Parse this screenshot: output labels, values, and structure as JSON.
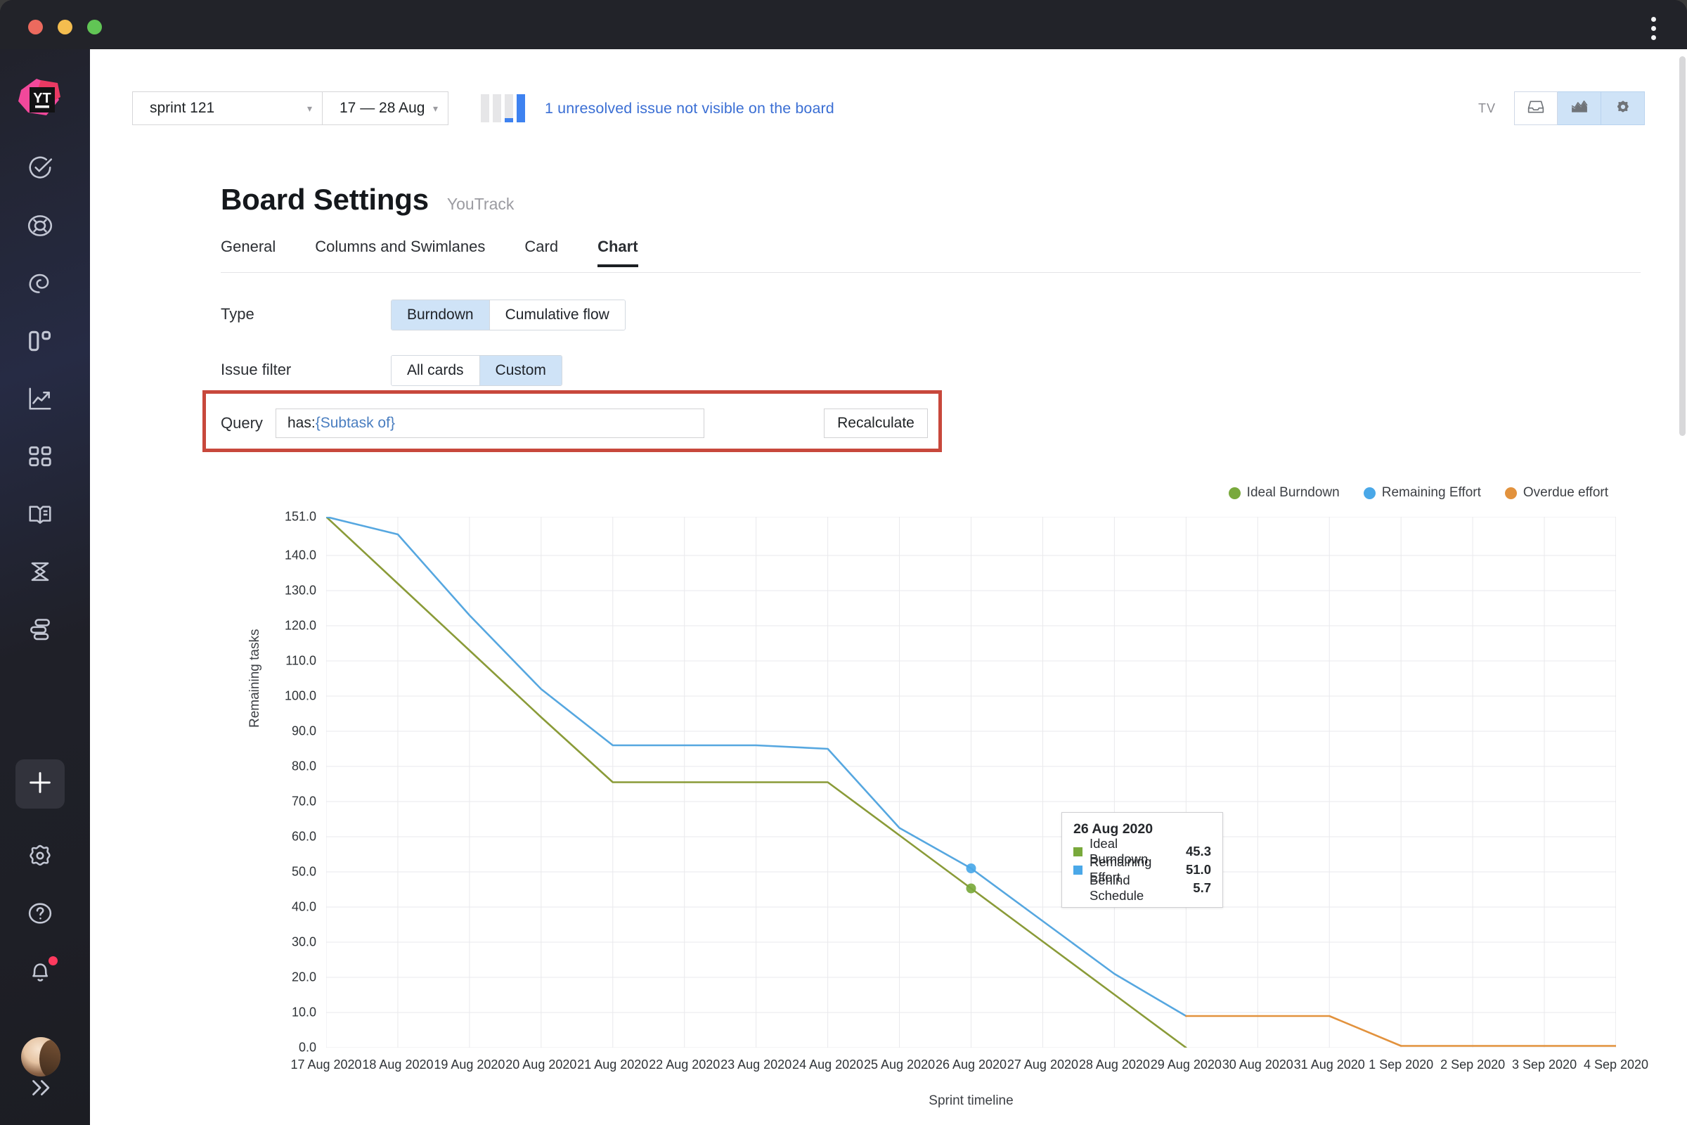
{
  "window": {
    "traffic_lights": [
      "close",
      "minimize",
      "zoom"
    ],
    "menu_icon": "kebab-menu-icon"
  },
  "sidebar": {
    "logo_label": "YT",
    "items": [
      {
        "name": "sidebar-item-issues",
        "icon": "check-circle-icon"
      },
      {
        "name": "sidebar-item-agile",
        "icon": "target-icon"
      },
      {
        "name": "sidebar-item-reports",
        "icon": "spiral-icon"
      },
      {
        "name": "sidebar-item-boards",
        "icon": "board-columns-icon"
      },
      {
        "name": "sidebar-item-analytics",
        "icon": "trend-up-icon"
      },
      {
        "name": "sidebar-item-dashboard",
        "icon": "grid-squares-icon"
      },
      {
        "name": "sidebar-item-knowledge",
        "icon": "book-open-icon"
      },
      {
        "name": "sidebar-item-timesheet",
        "icon": "hourglass-icon"
      },
      {
        "name": "sidebar-item-workflows",
        "icon": "layers-icon"
      }
    ],
    "add_button": {
      "name": "create-button",
      "icon": "plus-icon"
    },
    "bottom_items": [
      {
        "name": "sidebar-item-settings",
        "icon": "gear-icon"
      },
      {
        "name": "sidebar-item-help",
        "icon": "question-circle-icon"
      },
      {
        "name": "sidebar-item-notifications",
        "icon": "bell-icon",
        "badge": true
      }
    ],
    "avatar": {
      "name": "avatar",
      "icon": "user-avatar"
    },
    "expand": {
      "name": "expand-sidebar-button",
      "icon": "chevron-double-right-icon"
    }
  },
  "topbar": {
    "sprint_select": {
      "value": "sprint 121",
      "caret": "chevron-down-icon"
    },
    "date_select": {
      "value": "17 — 28 Aug",
      "caret": "chevron-down-icon"
    },
    "banner_text": "1 unresolved issue not visible on the board",
    "tv_label": "TV",
    "buttons": [
      {
        "name": "archive-button",
        "icon": "inbox-icon",
        "active": false
      },
      {
        "name": "chart-button",
        "icon": "chart-icon",
        "active": true
      },
      {
        "name": "settings-button",
        "icon": "gear-icon",
        "active": true
      }
    ]
  },
  "header": {
    "title": "Board Settings",
    "subtitle": "YouTrack"
  },
  "tabs": [
    {
      "label": "General",
      "active": false
    },
    {
      "label": "Columns and Swimlanes",
      "active": false
    },
    {
      "label": "Card",
      "active": false
    },
    {
      "label": "Chart",
      "active": true
    }
  ],
  "settings": {
    "type": {
      "label": "Type",
      "options": [
        {
          "label": "Burndown",
          "selected": true
        },
        {
          "label": "Cumulative flow",
          "selected": false
        }
      ]
    },
    "issue_filter": {
      "label": "Issue filter",
      "options": [
        {
          "label": "All cards",
          "selected": false
        },
        {
          "label": "Custom",
          "selected": true
        }
      ]
    },
    "query": {
      "label": "Query",
      "prefix": "has: ",
      "token": "{Subtask of}",
      "value": "has: {Subtask of}",
      "placeholder": "",
      "button_label": "Recalculate",
      "highlight_color": "#c8483c"
    }
  },
  "chart_data": {
    "type": "line",
    "title": "",
    "xlabel": "Sprint timeline",
    "ylabel": "Remaining tasks",
    "grid": true,
    "legend_position": "top-right",
    "ylim": [
      0,
      151
    ],
    "yticks": [
      0.0,
      10.0,
      20.0,
      30.0,
      40.0,
      50.0,
      60.0,
      70.0,
      80.0,
      90.0,
      100.0,
      110.0,
      120.0,
      130.0,
      140.0,
      151.0
    ],
    "ytick_labels": [
      "0.0",
      "10.0",
      "20.0",
      "30.0",
      "40.0",
      "50.0",
      "60.0",
      "70.0",
      "80.0",
      "90.0",
      "100.0",
      "110.0",
      "120.0",
      "130.0",
      "140.0",
      "151.0"
    ],
    "x": [
      "17 Aug 2020",
      "18 Aug 2020",
      "19 Aug 2020",
      "20 Aug 2020",
      "21 Aug 2020",
      "22 Aug 2020",
      "23 Aug 2020",
      "24 Aug 2020",
      "25 Aug 2020",
      "26 Aug 2020",
      "27 Aug 2020",
      "28 Aug 2020",
      "29 Aug 2020",
      "30 Aug 2020",
      "31 Aug 2020",
      "1 Sep 2020",
      "2 Sep 2020",
      "3 Sep 2020",
      "4 Sep 2020"
    ],
    "series": [
      {
        "name": "Ideal Burndown",
        "color": "#8a9b38",
        "values": [
          151.0,
          132.0,
          113.0,
          94.0,
          75.5,
          75.5,
          75.5,
          75.5,
          60.4,
          45.3,
          30.2,
          15.1,
          0.0,
          null,
          null,
          null,
          null,
          null,
          null
        ]
      },
      {
        "name": "Remaining Effort",
        "color": "#56a7e0",
        "values": [
          151.0,
          146.0,
          123.0,
          102.0,
          86.0,
          86.0,
          86.0,
          85.0,
          62.5,
          51.0,
          36.0,
          21.0,
          9.0,
          null,
          null,
          null,
          null,
          null,
          null
        ]
      },
      {
        "name": "Overdue effort",
        "color": "#e2923d",
        "values": [
          null,
          null,
          null,
          null,
          null,
          null,
          null,
          null,
          null,
          null,
          null,
          null,
          9.0,
          9.0,
          9.0,
          0.5,
          0.5,
          0.5,
          0.5
        ]
      }
    ],
    "legend": [
      {
        "label": "Ideal Burndown",
        "color": "#79a93c"
      },
      {
        "label": "Remaining Effort",
        "color": "#4aa8e8"
      },
      {
        "label": "Overdue effort",
        "color": "#e2923d"
      }
    ],
    "markers": [
      {
        "series": "Ideal Burndown",
        "x": "26 Aug 2020",
        "y": 45.3,
        "color": "#79a93c"
      },
      {
        "series": "Remaining Effort",
        "x": "26 Aug 2020",
        "y": 51.0,
        "color": "#4aa8e8"
      }
    ],
    "tooltip": {
      "date": "26 Aug 2020",
      "rows": [
        {
          "label": "Ideal Burndown",
          "value": "45.3",
          "color": "#79a93c",
          "swatch": true
        },
        {
          "label": "Remaining Effort",
          "value": "51.0",
          "color": "#4aa8e8",
          "swatch": true
        },
        {
          "label": "Behind Schedule",
          "value": "5.7",
          "color": "",
          "swatch": false
        }
      ]
    }
  }
}
